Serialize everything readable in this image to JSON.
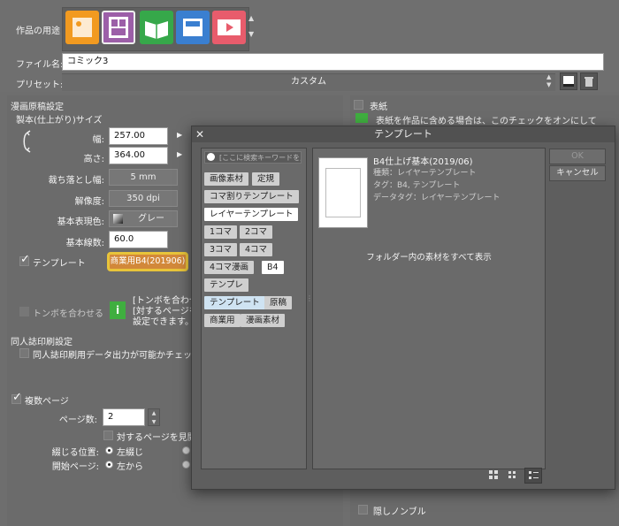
{
  "top": {
    "usage_label": "作品の用途",
    "filename_label": "ファイル名:",
    "filename_value": "コミック3",
    "preset_label": "プリセット:",
    "preset_value": "カスタム"
  },
  "manga": {
    "section_title": "漫画原稿設定",
    "size_title": "製本(仕上がり)サイズ",
    "width_label": "幅:",
    "width_value": "257.00",
    "height_label": "高さ:",
    "height_value": "364.00",
    "bleed_label": "裁ち落とし幅:",
    "bleed_value": "5 mm",
    "resolution_label": "解像度:",
    "resolution_value": "350 dpi",
    "color_label": "基本表現色:",
    "color_value": "グレー",
    "lines_label": "基本線数:",
    "lines_value": "60.0",
    "template_label": "テンプレート",
    "template_name": "商業用B4(201906)",
    "tombo_label": "トンボを合わせる",
    "info_text_1": "[トンボを合わせ",
    "info_text_2": "[対するページを",
    "info_text_3": "設定できます。"
  },
  "doujin": {
    "section_title": "同人誌印刷設定",
    "check_label": "同人誌印刷用データ出力が可能かチェックす"
  },
  "multi": {
    "label": "複数ページ",
    "pages_label": "ページ数:",
    "pages_value": "2",
    "spread_label": "対するページを見開",
    "binding_label": "綴じる位置:",
    "binding_value": "左綴じ",
    "start_label": "開始ページ:",
    "start_value": "左から"
  },
  "right": {
    "cover_label": "表紙",
    "cover_desc": "表紙を作品に含める場合は、このチェックをオンにして",
    "hidden_nombre": "隠しノンブル"
  },
  "dialog": {
    "title": "テンプレート",
    "search_placeholder": "[ここに検索キーワードを入力]",
    "tags": [
      "画像素材",
      "定規",
      "コマ割りテンプレート",
      "レイヤーテンプレート",
      "1コマ",
      "2コマ",
      "3コマ",
      "4コマ",
      "4コマ漫画",
      "B4",
      "テンプレ",
      "テンプレート",
      "原稿",
      "商業用",
      "漫画素材"
    ],
    "item_title": "B4仕上げ基本(2019/06)",
    "item_type": "種類：レイヤーテンプレート",
    "item_tag": "タグ：B4, テンプレート",
    "item_datatag": "データタグ：レイヤーテンプレート",
    "show_all": "フォルダー内の素材をすべて表示",
    "ok": "OK",
    "cancel": "キャンセル"
  },
  "colors": {
    "accent_orange": "#d2883a",
    "highlight_yellow": "#e8c43a"
  }
}
